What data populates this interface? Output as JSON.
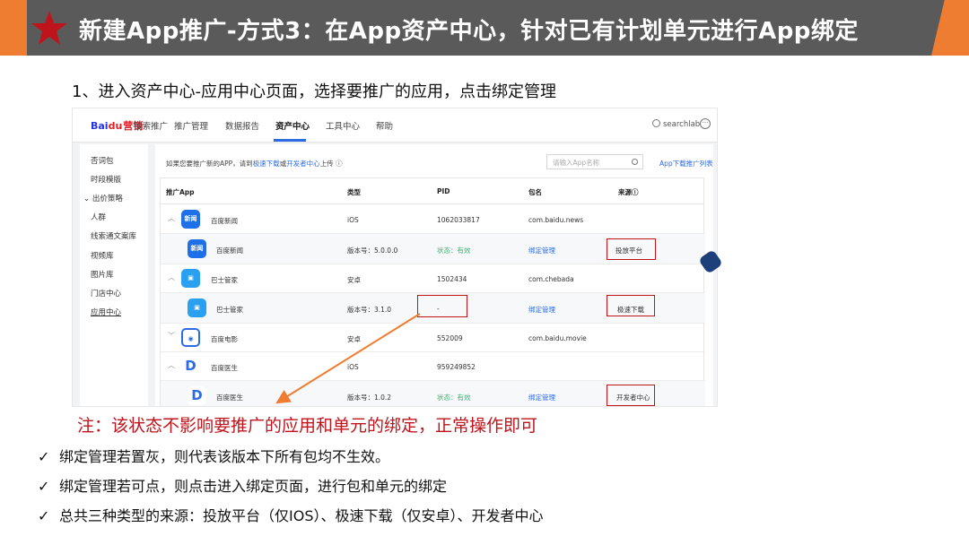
{
  "header": {
    "title": "新建App推广-方式3：在App资产中心，针对已有计划单元进行App绑定"
  },
  "step": "1、进入资产中心-应用中心页面，选择要推广的应用，点击绑定管理",
  "screenshot": {
    "logo_text": "Bai",
    "logo_paw": "du",
    "logo_sub": "营销",
    "nav": [
      "搜索推广",
      "推广管理",
      "数据报告",
      "资产中心",
      "工具中心",
      "帮助"
    ],
    "user": "searchlab",
    "more": "···",
    "sidebar": [
      "否词包",
      "时段模版",
      "出价策略",
      "人群",
      "线索通文案库",
      "视频库",
      "图片库",
      "门店中心",
      "应用中心"
    ],
    "notice_prefix": "如果您要推广新的APP，请到",
    "notice_link1": "极速下载",
    "notice_mid": "或",
    "notice_link2": "开发者中心",
    "notice_suffix": "上传 ⓘ",
    "search_placeholder": "请输入App名称",
    "list_link": "App下载推广列表",
    "columns": [
      "推广App",
      "类型",
      "PID",
      "包名",
      "来源ⓘ"
    ],
    "rows": [
      {
        "name": "百度新闻",
        "type": "iOS",
        "pid": "1062033817",
        "pkg": "com.baidu.news",
        "icon": "新闻"
      },
      {
        "name": "百度新闻",
        "type": "版本号：5.0.0.0",
        "pid": "状态：有效",
        "pkg": "绑定管理",
        "source": "投放平台",
        "icon": "新闻"
      },
      {
        "name": "巴士管家",
        "type": "安卓",
        "pid": "1502434",
        "pkg": "com.chebada",
        "icon": "▣"
      },
      {
        "name": "巴士管家",
        "type": "版本号：3.1.0",
        "pid": "-",
        "pkg": "绑定管理",
        "source": "极速下载",
        "icon": "▣"
      },
      {
        "name": "百度电影",
        "type": "安卓",
        "pid": "552009",
        "pkg": "com.baidu.movie",
        "icon": "◉"
      },
      {
        "name": "百度医生",
        "type": "iOS",
        "pid": "959249852",
        "pkg": "",
        "icon": "D"
      },
      {
        "name": "百度医生",
        "type": "版本号：1.0.2",
        "pid": "状态：有效",
        "pkg": "绑定管理",
        "source": "开发者中心",
        "icon": "D"
      }
    ]
  },
  "note": "注：该状态不影响要推广的应用和单元的绑定，正常操作即可",
  "bullets": [
    "绑定管理若置灰，则代表该版本下所有包均不生效。",
    "绑定管理若可点，则点击进入绑定页面，进行包和单元的绑定",
    "总共三种类型的来源：投放平台（仅IOS）、极速下载（仅安卓）、开发者中心"
  ],
  "checkmark": "✓",
  "colors": {
    "header_bg": "#5a5a5a",
    "accent_orange": "#ef7d31",
    "star_red": "#c0141c",
    "note_red": "#c0141c",
    "link_blue": "#2d6be4",
    "status_green": "#3cb371"
  }
}
